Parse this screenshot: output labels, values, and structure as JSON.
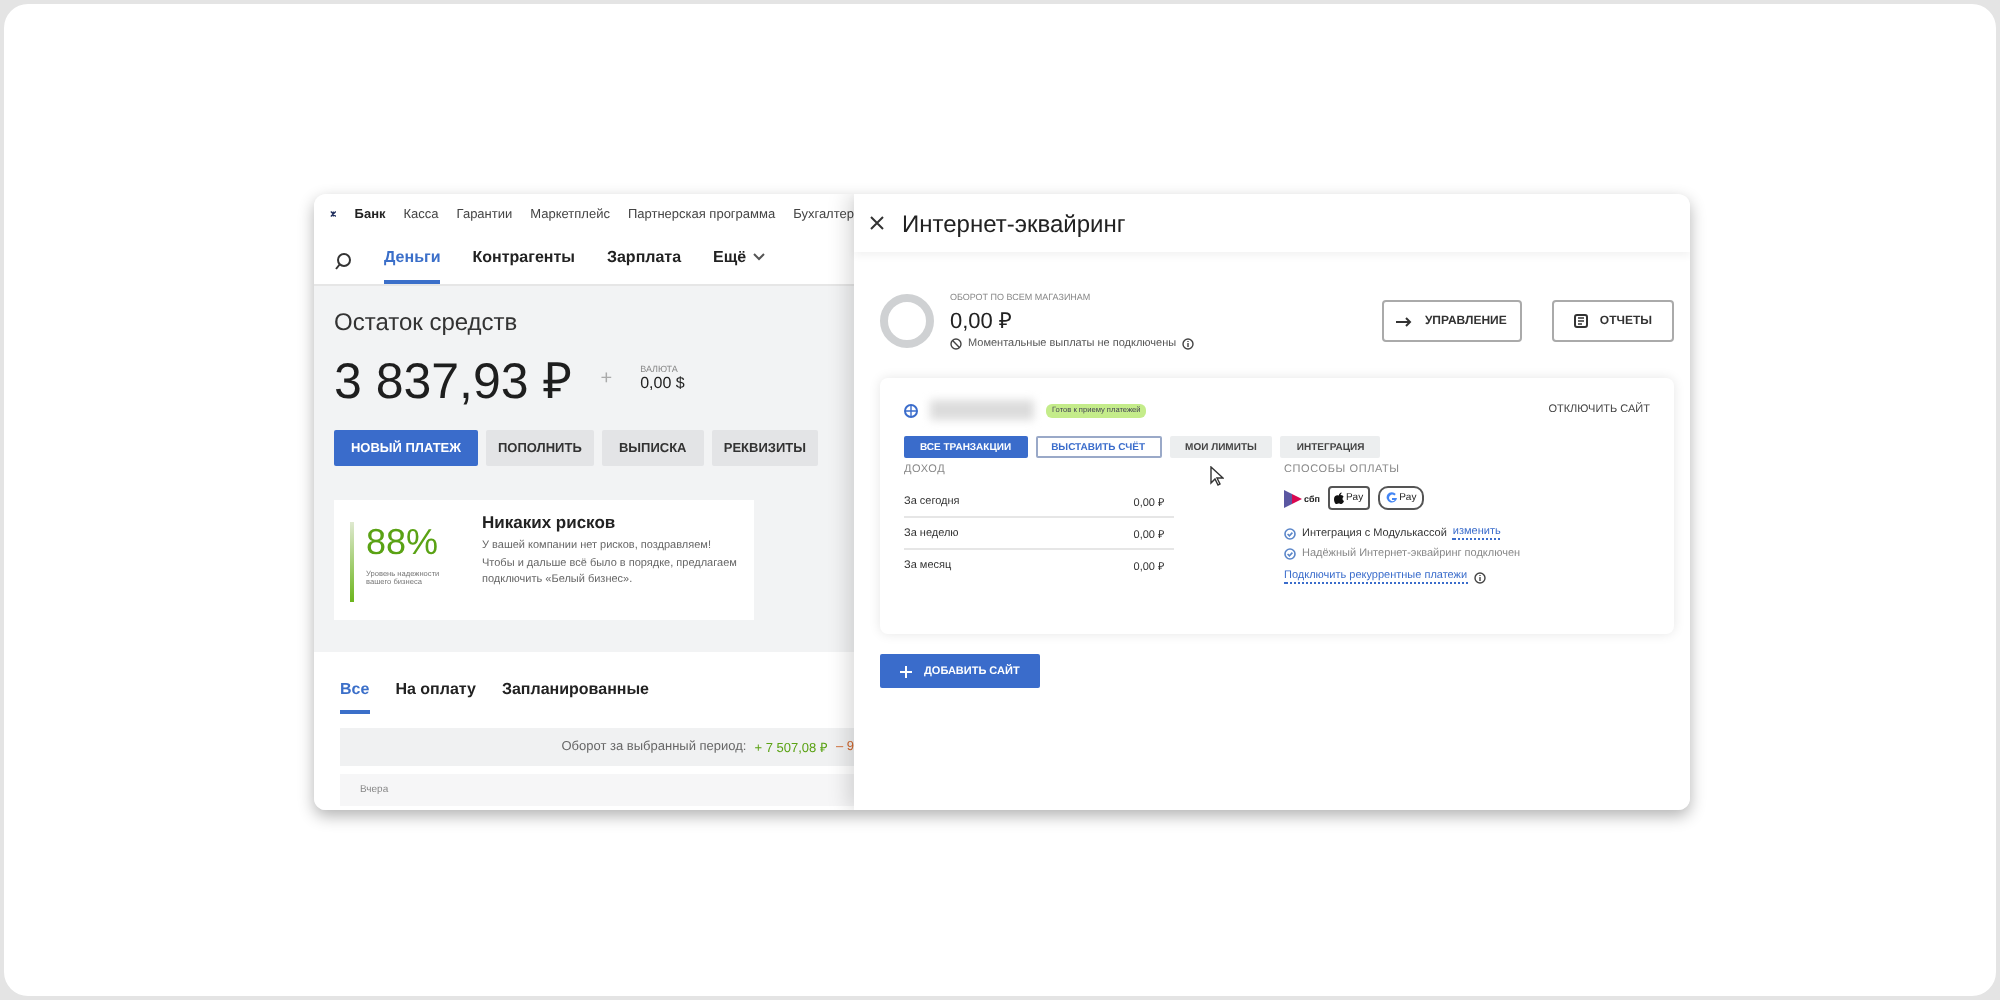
{
  "top_nav": {
    "items": [
      {
        "label": "Банк",
        "selected": true
      },
      {
        "label": "Касса",
        "selected": false
      },
      {
        "label": "Гарантии",
        "selected": false
      },
      {
        "label": "Маркетплейс",
        "selected": false
      },
      {
        "label": "Партнерская программа",
        "selected": false
      },
      {
        "label": "Бухгалтер",
        "selected": false
      }
    ]
  },
  "sub_nav": {
    "items": [
      {
        "label": "Деньги",
        "selected": true,
        "kind": "link"
      },
      {
        "label": "Контрагенты",
        "selected": false,
        "kind": "link"
      },
      {
        "label": "Зарплата",
        "selected": false,
        "kind": "link"
      },
      {
        "label": "Ещё",
        "selected": false,
        "kind": "dropdown"
      }
    ]
  },
  "balance": {
    "title": "Остаток средств",
    "amount": "3 837,93 ₽",
    "plus": "+",
    "currency_label": "ВАЛЮТА",
    "currency_amount": "0,00 $"
  },
  "actions": [
    {
      "label": "НОВЫЙ ПЛАТЕЖ",
      "kind": "primary"
    },
    {
      "label": "ПОПОЛНИТЬ",
      "kind": "secondary"
    },
    {
      "label": "ВЫПИСКА",
      "kind": "secondary"
    },
    {
      "label": "РЕКВИЗИТЫ",
      "kind": "secondary"
    }
  ],
  "reliability": {
    "percent": "88%",
    "caption": "Уровень надежности вашего бизнеса",
    "title": "Никаких рисков",
    "text": "У вашей компании нет рисков, поздравляем! Чтобы и дальше всё было в порядке, предлагаем подключить «Белый бизнес»."
  },
  "feed": {
    "tabs": [
      {
        "label": "Все",
        "selected": true
      },
      {
        "label": "На оплату",
        "selected": false
      },
      {
        "label": "Запланированные",
        "selected": false
      }
    ],
    "turnover_label": "Оборот за выбранный период:",
    "income": "+ 7 507,08 ₽",
    "expense": "– 9",
    "group": "Вчера"
  },
  "panel": {
    "title": "Интернет-эквайринг",
    "turnover_label": "ОБОРОТ ПО ВСЕМ МАГАЗИНАМ",
    "turnover": "0,00 ₽",
    "payouts_note": "Моментальные выплаты не подключены",
    "buttons": [
      {
        "label": "УПРАВЛЕНИЕ",
        "kind": "arrow"
      },
      {
        "label": "ОТЧЕТЫ",
        "kind": "report"
      }
    ],
    "site": {
      "status": "Готов к приему платежей",
      "disable": "ОТКЛЮЧИТЬ САЙТ",
      "tabs": [
        {
          "label": "ВСЕ ТРАНЗАКЦИИ",
          "selected": true,
          "kind": "filled"
        },
        {
          "label": "ВЫСТАВИТЬ СЧЁТ",
          "selected": false,
          "kind": "outline"
        },
        {
          "label": "МОИ ЛИМИТЫ",
          "selected": false,
          "kind": "plain"
        },
        {
          "label": "ИНТЕГРАЦИЯ",
          "selected": false,
          "kind": "plain"
        }
      ],
      "income_label": "ДОХОД",
      "income_rows": [
        {
          "label": "За сегодня",
          "value": "0,00 ₽"
        },
        {
          "label": "За неделю",
          "value": "0,00 ₽"
        },
        {
          "label": "За месяц",
          "value": "0,00 ₽"
        }
      ],
      "methods_label": "СПОСОБЫ ОПЛАТЫ",
      "methods": [
        {
          "kind": "sbp",
          "label": "сбп"
        },
        {
          "kind": "apple",
          "label": "Pay"
        },
        {
          "kind": "google",
          "label": "Pay"
        }
      ],
      "integration": "Интеграция с Модулькассой",
      "integration_link": "изменить",
      "reliable": "Надёжный Интернет-эквайринг подключен",
      "recurring_link": "Подключить рекуррентные платежи"
    },
    "add_site": "ДОБАВИТЬ САЙТ"
  }
}
